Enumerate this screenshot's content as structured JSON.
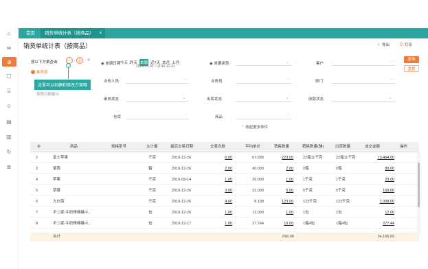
{
  "tabs": {
    "home": "首页",
    "report": "销货单统计表（按商品）",
    "close": "×"
  },
  "page_title": "销货单统计表（按商品）",
  "toolbar": {
    "export": "导出",
    "print": "打印"
  },
  "side_buttons": {
    "query": "查询",
    "reset": "重置"
  },
  "filters": {
    "plan_label": "按以下方案查询",
    "plan_tag": "推荐度",
    "tooltip": "这里可以创建和修改方案哦",
    "hidden_text": "按照日期展示",
    "doc_date_label": "单据日期",
    "date_options": [
      "今天",
      "昨天",
      "本周",
      "近7天",
      "本月",
      "上月",
      "本年"
    ],
    "date_range": "2019-01-01 ~ 2019-12-31",
    "labels": {
      "customer_type": "单据类型",
      "customer": "客户",
      "business_staff": "业务人员",
      "salesperson": "业务员",
      "department": "部门",
      "audit_status": "审核状态",
      "outbound_status": "出库状态",
      "collection_status": "收款状态",
      "warehouse": "仓库",
      "goods": "商品"
    },
    "more_filter": "收起更多条件"
  },
  "grid": {
    "headers": [
      "#",
      "商品",
      "规格型号",
      "主计量",
      "最后交易日期",
      "交易次数",
      "平均单价",
      "销售数量",
      "销售数量(辅)",
      "出库数量",
      "出库数量(辅)",
      "成交金额",
      "操作"
    ],
    "rows": [
      [
        "2",
        "富士苹果",
        "",
        "千克",
        "2019-12-26",
        "6.00",
        "67.280",
        "223.00",
        "22箱11千克",
        "223.00",
        "22箱11千克",
        "13,464.00"
      ],
      [
        "3",
        "笔筒",
        "",
        "箱",
        "2019-12-26",
        "2.00",
        "40.000",
        "2.00",
        "2箱",
        "2.00",
        "2箱",
        "80.00"
      ],
      [
        "4",
        "苹果",
        "",
        "千克",
        "2019-08-14",
        "1.00",
        "20.000",
        "1.00",
        "1千克",
        "1.00",
        "1千克",
        "20.00"
      ],
      [
        "5",
        "草莓",
        "",
        "千克",
        "2019-12-26",
        "3.00",
        "32.000",
        "5.00",
        "5千克",
        "5.00",
        "5千克",
        "160.00"
      ],
      [
        "6",
        "大白菜",
        "",
        "千克",
        "2019-12-26",
        "4.00",
        "8.198",
        "123.00",
        "123千克",
        "123.00",
        "123千克",
        "1,008.00"
      ],
      [
        "7",
        "不二家-牛奶棒棒糖-0...",
        "",
        "包",
        "2019-12-26",
        "1.00",
        "12.000",
        "1.00",
        "1包",
        "1.00",
        "1包",
        "12.00"
      ],
      [
        "8",
        "不二家-牛奶棒棒糖-0...",
        "",
        "包",
        "2019-12-17",
        "1.00",
        "27.744",
        "10.00",
        "1箱4包",
        "10.00",
        "1箱4包",
        "277.44"
      ]
    ],
    "totals": {
      "label": "合计",
      "qty": "690.00",
      "amount": "34,106.00"
    }
  },
  "colors": {
    "accent": "#f07a3a",
    "tabbar": "#2aa8a0"
  },
  "nav_icons": [
    "home-icon",
    "mail-icon",
    "report-icon",
    "calendar-icon",
    "shop-icon",
    "user-group-icon",
    "doc-icon",
    "chart-icon",
    "refresh-icon",
    "list-icon"
  ]
}
